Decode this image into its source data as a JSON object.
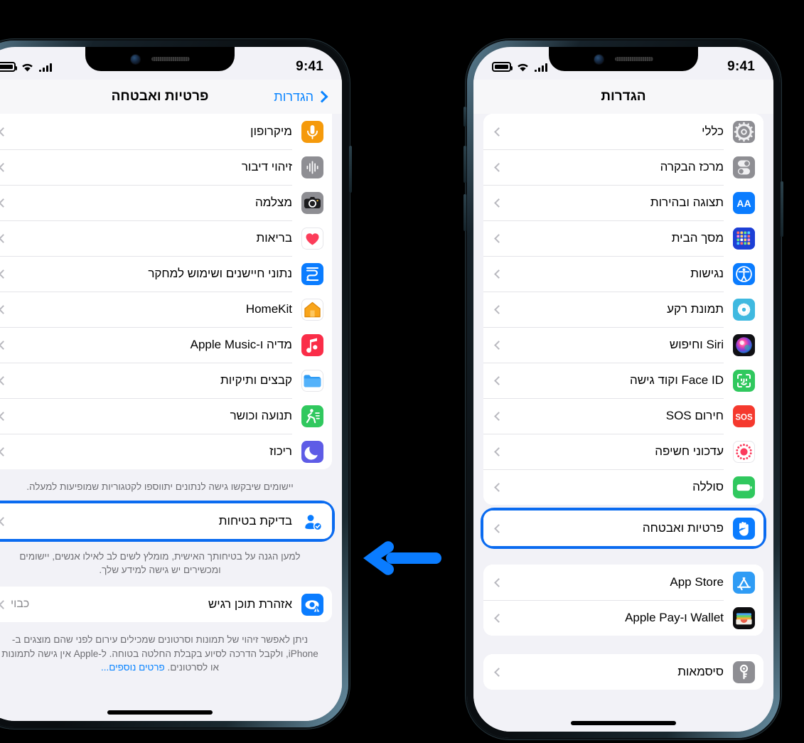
{
  "meta": {
    "background": "#000000",
    "accent_blue": "#0a84ff",
    "highlight_ring": "#0a6bf0"
  },
  "arrow": {
    "name": "left-arrow",
    "direction": "left",
    "color": "#0a7cff",
    "meaning": "from Settings screen to Privacy & Security screen"
  },
  "left_phone": {
    "status_bar": {
      "time": "9:41",
      "icons": [
        "battery-icon",
        "wifi-icon",
        "cellular-signal-icon"
      ]
    },
    "nav": {
      "back_label": "הגדרות",
      "title": "פרטיות ואבטחה"
    },
    "list": [
      {
        "label": "מיקרופון",
        "icon": "microphone-icon",
        "icon_bg": "#f59a0b"
      },
      {
        "label": "זיהוי דיבור",
        "icon": "speech-waveform-icon",
        "icon_bg": "#8e8e93"
      },
      {
        "label": "מצלמה",
        "icon": "camera-icon",
        "icon_bg": "#8e8e93"
      },
      {
        "label": "בריאות",
        "icon": "health-heart-icon",
        "icon_bg": "#ffffff"
      },
      {
        "label": "נתוני חיישנים ושימוש למחקר",
        "icon": "research-sensor-icon",
        "icon_bg": "#0a7cff"
      },
      {
        "label": "HomeKit",
        "icon": "home-icon",
        "icon_bg": "#ffffff"
      },
      {
        "label": "מדיה ו-Apple Music",
        "icon": "apple-music-icon",
        "icon_bg": "#fa2d48"
      },
      {
        "label": "קבצים ותיקיות",
        "icon": "files-folder-icon",
        "icon_bg": "#ffffff"
      },
      {
        "label": "תנועה וכושר",
        "icon": "fitness-icon",
        "icon_bg": "#30c85e"
      },
      {
        "label": "ריכוז",
        "icon": "focus-moon-icon",
        "icon_bg": "#5e5ce6"
      }
    ],
    "list_footnote": "יישומים שיבקשו גישה לנתונים יתווספו לקטגוריות שמופיעות למעלה.",
    "safety_check": {
      "label": "בדיקת בטיחות",
      "icon": "safety-check-person-icon",
      "icon_bg": "#ffffff",
      "highlighted": true
    },
    "safety_check_footnote": "למען הגנה על בטיחותך האישית, מומלץ לשים לב לאילו אנשים, יישומים ומכשירים יש גישה למידע שלך.",
    "sensitive": {
      "label": "אזהרת תוכן רגיש",
      "value": "כבוי",
      "icon": "sensitive-content-eye-icon",
      "icon_bg": "#0a7cff"
    },
    "sensitive_footnote_text": "ניתן לאפשר זיהוי של תמונות וסרטונים שמכילים עירום לפני שהם מוצגים ב-iPhone, ולקבל הדרכה לסיוע בקבלת החלטה בטוחה. ל-Apple אין גישה לתמונות או לסרטונים. ",
    "sensitive_footnote_link": "פרטים נוספים..."
  },
  "right_phone": {
    "status_bar": {
      "time": "9:41",
      "icons": [
        "battery-icon",
        "wifi-icon",
        "cellular-signal-icon"
      ]
    },
    "nav": {
      "title": "הגדרות"
    },
    "group_1": [
      {
        "label": "כללי",
        "icon": "gear-icon",
        "icon_bg": "#8e8e93"
      },
      {
        "label": "מרכז הבקרה",
        "icon": "control-center-icon",
        "icon_bg": "#8e8e93"
      },
      {
        "label": "תצוגה ובהירות",
        "icon": "display-aa-icon",
        "icon_bg": "#0a7cff"
      },
      {
        "label": "מסך הבית",
        "icon": "home-screen-icon",
        "icon_bg": "#1d3fd6"
      },
      {
        "label": "נגישות",
        "icon": "accessibility-icon",
        "icon_bg": "#0a7cff"
      },
      {
        "label": "תמונת רקע",
        "icon": "wallpaper-icon",
        "icon_bg": "#3fb9e0"
      },
      {
        "label": "Siri וחיפוש",
        "icon": "siri-icon",
        "icon_bg": "#101014"
      },
      {
        "label": "Face ID וקוד גישה",
        "icon": "face-id-icon",
        "icon_bg": "#30c85e"
      },
      {
        "label": "חירום SOS",
        "icon": "sos-icon",
        "icon_bg": "#f5392e"
      },
      {
        "label": "עדכוני חשיפה",
        "icon": "exposure-icon",
        "icon_bg": "#ffffff"
      },
      {
        "label": "סוללה",
        "icon": "battery-green-icon",
        "icon_bg": "#30c85e"
      }
    ],
    "privacy_row": {
      "label": "פרטיות ואבטחה",
      "icon": "privacy-hand-icon",
      "icon_bg": "#0a7cff",
      "highlighted": true
    },
    "group_2": [
      {
        "label": "App Store",
        "icon": "app-store-icon",
        "icon_bg": "#2f9cf5"
      },
      {
        "label": "Wallet ו-Apple Pay",
        "icon": "wallet-icon",
        "icon_bg": "#0d0d0f"
      }
    ],
    "group_3": [
      {
        "label": "סיסמאות",
        "icon": "passwords-key-icon",
        "icon_bg": "#8e8e93"
      }
    ]
  }
}
